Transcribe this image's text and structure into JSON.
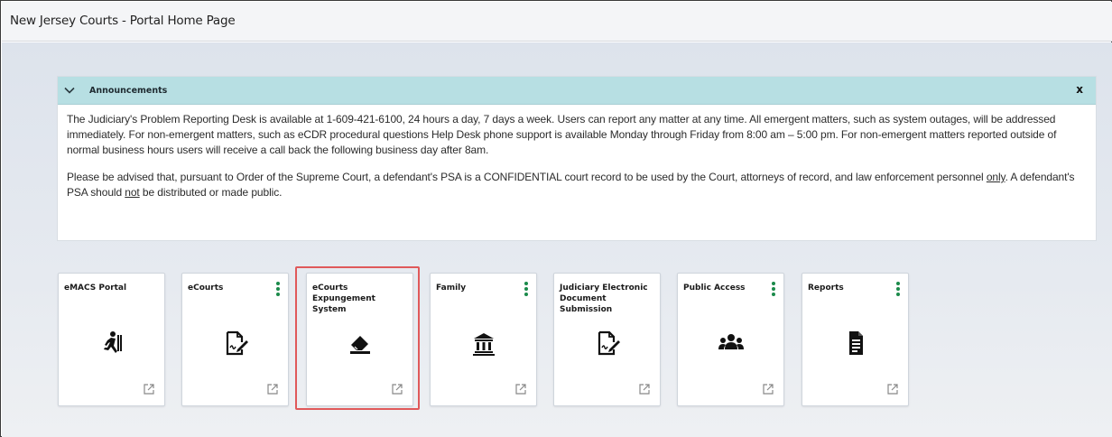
{
  "page": {
    "title": "New Jersey Courts - Portal Home Page"
  },
  "announcements": {
    "title": "Announcements",
    "close_label": "x",
    "paragraph1": "The Judiciary's Problem Reporting Desk is available at 1-609-421-6100, 24 hours a day, 7 days a week. Users can report any matter at any time.  All emergent matters, such as system outages, will be addressed immediately. For non-emergent matters, such as eCDR procedural questions Help Desk phone support is available Monday through Friday from 8:00 am – 5:00 pm.  For non-emergent matters reported outside of normal business hours users will receive a call back the following business day after 8am.",
    "paragraph2_part1": "Please be advised that, pursuant to Order of the Supreme Court, a defendant's PSA is a CONFIDENTIAL court record to be used by the Court, attorneys of record, and law enforcement personnel ",
    "paragraph2_only": "only",
    "paragraph2_part2": ".  A defendant's PSA should ",
    "paragraph2_not": "not",
    "paragraph2_part3": " be distributed or made public."
  },
  "tiles": [
    {
      "label": "eMACS Portal",
      "icon": "running-figure-icon",
      "has_menu": false
    },
    {
      "label": "eCourts",
      "icon": "document-signature-icon",
      "has_menu": true
    },
    {
      "label": "eCourts Expungement System",
      "icon": "eraser-icon",
      "has_menu": false,
      "highlighted": true
    },
    {
      "label": "Family",
      "icon": "courthouse-icon",
      "has_menu": true
    },
    {
      "label": "Judiciary Electronic Document Submission",
      "icon": "document-signature-icon",
      "has_menu": false
    },
    {
      "label": "Public Access",
      "icon": "users-icon",
      "has_menu": true
    },
    {
      "label": "Reports",
      "icon": "report-document-icon",
      "has_menu": true
    }
  ],
  "colors": {
    "announcement_header": "#b7dfe3",
    "menu_dots": "#1a8a4a",
    "highlight_border": "#e0595a"
  }
}
